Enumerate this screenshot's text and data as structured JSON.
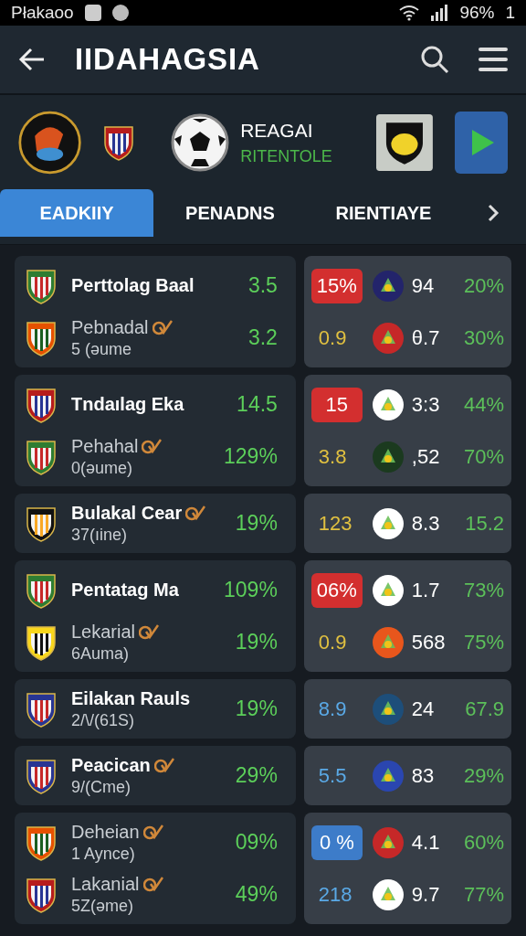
{
  "status_bar": {
    "carrier": "Płakaoo",
    "battery": "96%",
    "sim": "1"
  },
  "app_bar": {
    "title": "IIDAHAGSIA"
  },
  "featured": {
    "title": "REAGAI",
    "subtitle": "RITENTOLE"
  },
  "tabs": [
    {
      "label": "EADKIIY",
      "selected": true
    },
    {
      "label": "PENADNS",
      "selected": false
    },
    {
      "label": "RIENTIAYE",
      "selected": false
    }
  ],
  "matches": [
    {
      "teams": [
        {
          "name": "Perttolag Baal",
          "kind": "main",
          "verified": false,
          "value": "3.5"
        },
        {
          "name": "Pebnadal",
          "sub": "5 (əume",
          "kind": "sub",
          "verified": true,
          "value": "3.2"
        }
      ],
      "odds": [
        {
          "badge": {
            "text": "15%",
            "kind": "pill",
            "color": "#d32f2f"
          },
          "emblem": {
            "color": "#23246b"
          },
          "value": "94",
          "pct": "20%"
        },
        {
          "badge": {
            "text": "0.9",
            "kind": "plain",
            "color": "#e0c040"
          },
          "emblem": {
            "color": "#c62828"
          },
          "value": "θ.7",
          "pct": "30%"
        }
      ]
    },
    {
      "teams": [
        {
          "name": "Tndaılag Eka",
          "kind": "main",
          "verified": false,
          "value": "14.5"
        },
        {
          "name": "Pehahal",
          "sub": "0(əume)",
          "kind": "sub",
          "verified": true,
          "value": "129%"
        }
      ],
      "odds": [
        {
          "badge": {
            "text": "15",
            "kind": "pill",
            "color": "#d32f2f"
          },
          "emblem": {
            "color": "#ffffff"
          },
          "value": "3:3",
          "pct": "44%"
        },
        {
          "badge": {
            "text": "3.8",
            "kind": "plain",
            "color": "#e0c040"
          },
          "emblem": {
            "color": "#1b3a1f"
          },
          "value": ",52",
          "pct": "70%"
        }
      ]
    },
    {
      "teams": [
        {
          "name": "Bulakal Cear",
          "sub": "37(ıine)",
          "kind": "main",
          "verified": true,
          "value": "19%"
        }
      ],
      "odds": [
        {
          "badge": {
            "text": "123",
            "kind": "plain",
            "color": "#e0c040"
          },
          "emblem": {
            "color": "#ffffff"
          },
          "value": "8.3",
          "pct": "15.2"
        }
      ]
    },
    {
      "teams": [
        {
          "name": "Pentatag Ma",
          "kind": "main",
          "verified": false,
          "value": "109%"
        },
        {
          "name": "Lekarial",
          "sub": "6Auma)",
          "kind": "sub",
          "verified": true,
          "value": "19%"
        }
      ],
      "odds": [
        {
          "badge": {
            "text": "06%",
            "kind": "pill",
            "color": "#d32f2f"
          },
          "emblem": {
            "color": "#ffffff"
          },
          "value": "1.7",
          "pct": "73%"
        },
        {
          "badge": {
            "text": "0.9",
            "kind": "plain",
            "color": "#e0c040"
          },
          "emblem": {
            "color": "#e8561c"
          },
          "value": "568",
          "pct": "75%"
        }
      ]
    },
    {
      "teams": [
        {
          "name": "Eilakan Rauls",
          "sub": "2/\\/(61S)",
          "kind": "main",
          "verified": false,
          "value": "19%"
        }
      ],
      "odds": [
        {
          "badge": {
            "text": "8.9",
            "kind": "plain",
            "color": "#5aa9e6"
          },
          "emblem": {
            "color": "#1d4e7a"
          },
          "value": "24",
          "pct": "67.9"
        }
      ]
    },
    {
      "teams": [
        {
          "name": "Peacican",
          "sub": "9/(Cme)",
          "kind": "main",
          "verified": true,
          "value": "29%"
        }
      ],
      "odds": [
        {
          "badge": {
            "text": "5.5",
            "kind": "plain",
            "color": "#5aa9e6"
          },
          "emblem": {
            "color": "#2a46b0"
          },
          "value": "83",
          "pct": "29%"
        }
      ]
    },
    {
      "teams": [
        {
          "name": "Deheian",
          "sub": "1 Aynce)",
          "kind": "sub",
          "verified": true,
          "value": "09%"
        },
        {
          "name": "Lakanial",
          "sub": "5Z(əme)",
          "kind": "sub",
          "verified": true,
          "value": "49%"
        }
      ],
      "odds": [
        {
          "badge": {
            "text": "0 %",
            "kind": "pill",
            "color": "#3d7cc9"
          },
          "emblem": {
            "color": "#c62828"
          },
          "value": "4.1",
          "pct": "60%"
        },
        {
          "badge": {
            "text": "218",
            "kind": "plain",
            "color": "#5aa9e6"
          },
          "emblem": {
            "color": "#ffffff"
          },
          "value": "9.7",
          "pct": "77%"
        }
      ]
    }
  ]
}
